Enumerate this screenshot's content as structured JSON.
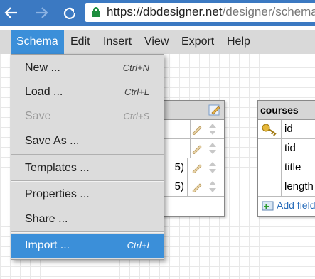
{
  "browser": {
    "url_host": "https://dbdesigner.net",
    "url_path": "/designer/schema"
  },
  "menubar": {
    "items": [
      "Schema",
      "Edit",
      "Insert",
      "View",
      "Export",
      "Help"
    ],
    "active": "Schema"
  },
  "schema_menu": {
    "items": [
      {
        "label": "New ...",
        "shortcut": "Ctrl+N"
      },
      {
        "label": "Load ...",
        "shortcut": "Ctrl+L"
      },
      {
        "label": "Save",
        "shortcut": "Ctrl+S",
        "disabled": true
      },
      {
        "label": "Save As ...",
        "shortcut": ""
      },
      {
        "label": "Templates ...",
        "shortcut": ""
      },
      {
        "label": "Properties ...",
        "shortcut": ""
      },
      {
        "label": "Share ...",
        "shortcut": ""
      },
      {
        "label": "Import ...",
        "shortcut": "Ctrl+I",
        "highlighted": true
      }
    ]
  },
  "table_left": {
    "rows": [
      "",
      "",
      "5)",
      "5)"
    ]
  },
  "table_courses": {
    "title": "courses",
    "fields": [
      "id",
      "tid",
      "title",
      "length"
    ],
    "add_field_label": "Add field"
  },
  "colors": {
    "browser_blue": "#3b79c2",
    "menu_highlight": "#3b8fd9",
    "menu_bg": "#d9d9d9",
    "link": "#2a6ebb"
  }
}
